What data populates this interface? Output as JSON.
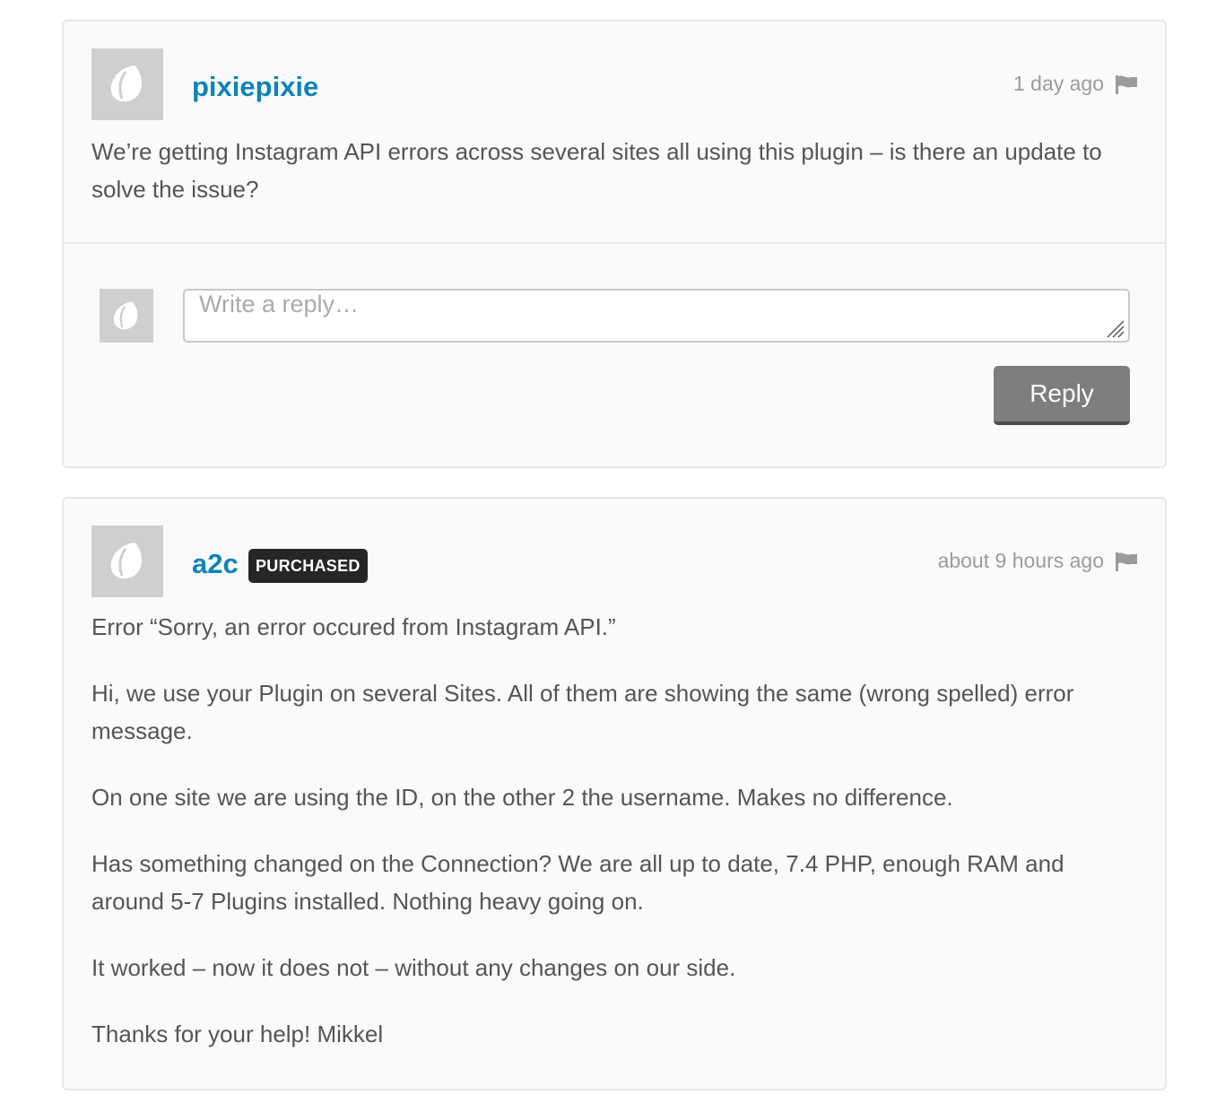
{
  "comments": [
    {
      "author": "pixiepixie",
      "time": "1 day ago",
      "paragraphs": [
        "We’re getting Instagram API errors across several sites all using this plugin – is there an update to solve the issue?"
      ]
    },
    {
      "author": "a2c",
      "badge": "PURCHASED",
      "time": "about 9 hours ago",
      "paragraphs": [
        "Error “Sorry, an error occured from Instagram API.”",
        "Hi, we use your Plugin on several Sites. All of them are showing the same (wrong spelled) error message.",
        "On one site we are using the ID, on the other 2 the username. Makes no difference.",
        "Has something changed on the Connection? We are all up to date, 7.4 PHP, enough RAM and around 5-7 Plugins installed. Nothing heavy going on.",
        "It worked – now it does not – without any changes on our side.",
        "Thanks for your help! Mikkel"
      ]
    }
  ],
  "reply": {
    "placeholder": "Write a reply…",
    "button_label": "Reply"
  },
  "colors": {
    "username": "#0f84b4",
    "badge_bg": "#262626",
    "button_bg": "#7e7e7e",
    "avatar_bg": "#cfcfcf"
  },
  "icons": {
    "avatar": "leaf-icon",
    "report": "flag-icon"
  }
}
